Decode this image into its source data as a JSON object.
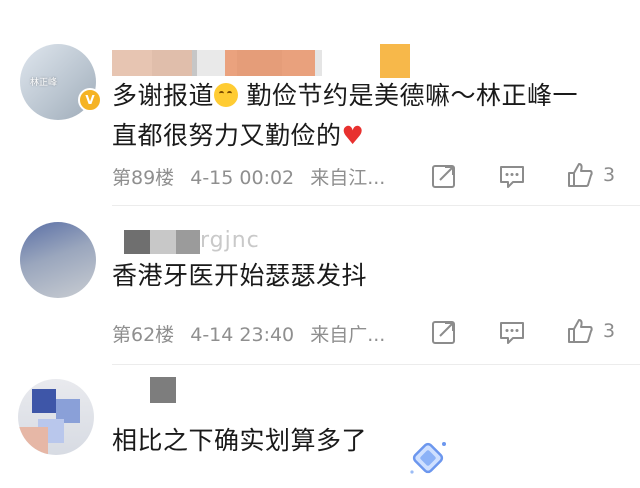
{
  "comments": [
    {
      "avatar_text": "林正峰",
      "text_parts": [
        "多谢报道",
        "勤俭节约是美德嘛～林正峰一",
        "直都很努力又勤俭的"
      ],
      "floor": "第89楼",
      "time": "4-15 00:02",
      "source": "来自江...",
      "likes": "3"
    },
    {
      "username_partial": "rgjnc",
      "text": "香港牙医开始瑟瑟发抖",
      "floor": "第62楼",
      "time": "4-14 23:40",
      "source": "来自广...",
      "likes": "3"
    },
    {
      "text": "相比之下确实划算多了"
    }
  ],
  "icons": [
    "verified-badge-icon",
    "smile-emoji-icon",
    "red-heart-icon",
    "share-icon",
    "reply-comment-icon",
    "thumbs-up-icon",
    "sticker-icon"
  ],
  "colors": {
    "text": "#1a1a1a",
    "meta": "#8f8f8f",
    "heart": "#e8312f",
    "badge": "#f5b324"
  }
}
